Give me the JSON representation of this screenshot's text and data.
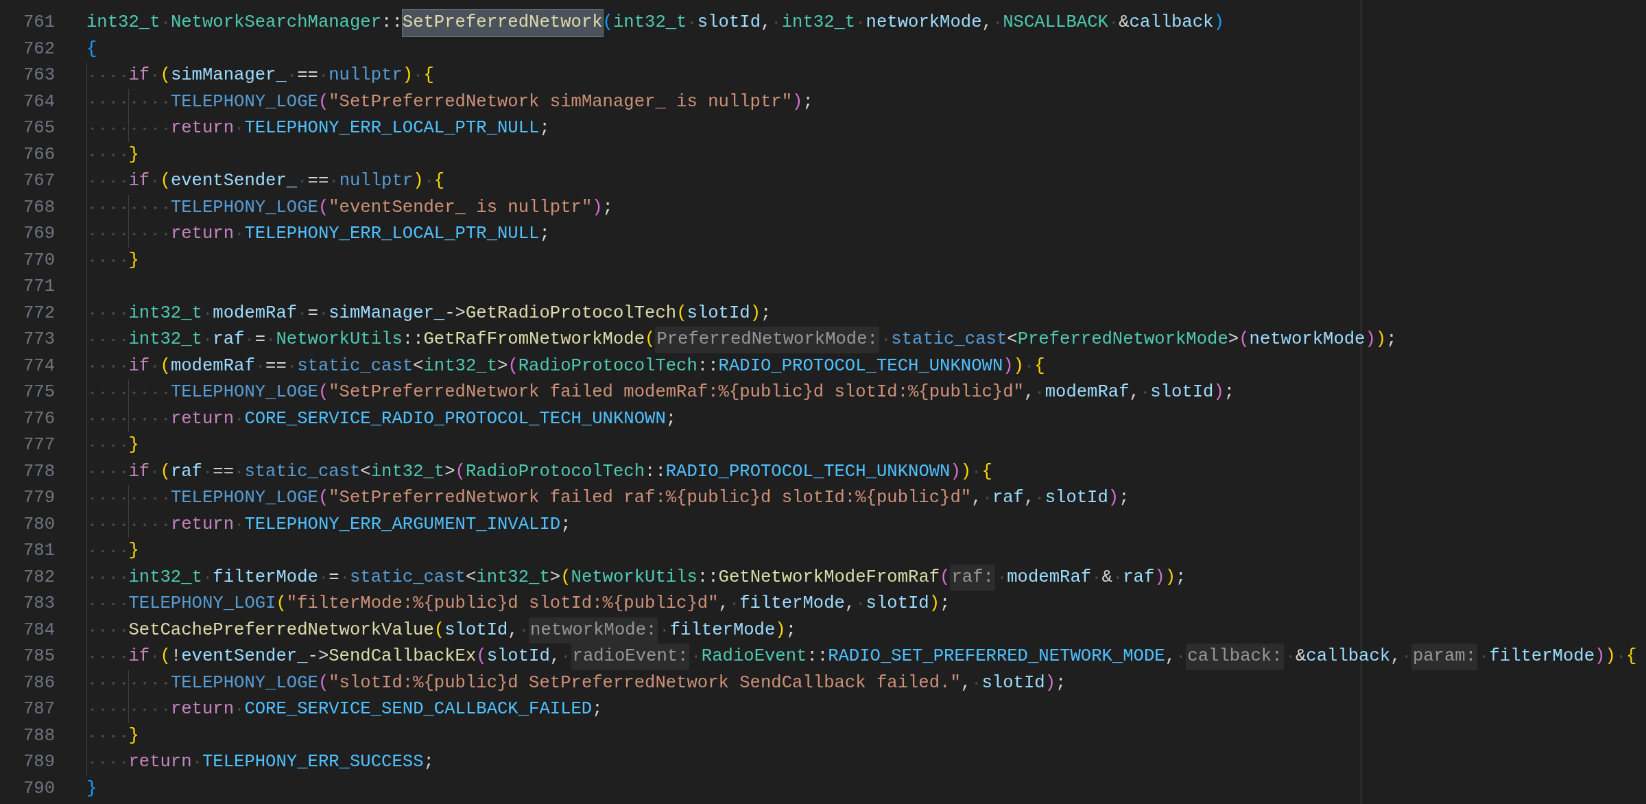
{
  "editor": {
    "lines": [
      {
        "number": "761",
        "tokens": [
          {
            "kind": "type",
            "text": "int32_t"
          },
          {
            "kind": "type",
            "text": "NetworkSearchManager",
            "space_before": true
          },
          {
            "kind": "plain",
            "text": "::"
          },
          {
            "kind": "selected",
            "text": "SetPreferredNetwork"
          },
          {
            "kind": "bracket3",
            "text": "("
          },
          {
            "kind": "type",
            "text": "int32_t"
          },
          {
            "kind": "var",
            "text": "slotId",
            "space_before": true
          },
          {
            "kind": "plain",
            "text": ","
          },
          {
            "kind": "type",
            "text": "int32_t",
            "space_before": true
          },
          {
            "kind": "var",
            "text": "networkMode",
            "space_before": true
          },
          {
            "kind": "plain",
            "text": ","
          },
          {
            "kind": "type",
            "text": "NSCALLBACK",
            "space_before": true
          },
          {
            "kind": "plain",
            "text": "&",
            "space_before": true
          },
          {
            "kind": "var",
            "text": "callback"
          },
          {
            "kind": "bracket3",
            "text": ")"
          }
        ]
      },
      {
        "number": "762",
        "tokens": [
          {
            "kind": "bracket3",
            "text": "{"
          }
        ],
        "children": [
          {
            "number": "763",
            "tokens": [
              {
                "kind": "keyword",
                "text": "if"
              },
              {
                "kind": "bracket1",
                "text": "(",
                "space_before": true
              },
              {
                "kind": "var",
                "text": "simManager_"
              },
              {
                "kind": "plain",
                "text": "==",
                "space_before": true
              },
              {
                "kind": "builtin",
                "text": "nullptr",
                "space_before": true
              },
              {
                "kind": "bracket1",
                "text": ")"
              },
              {
                "kind": "bracket1",
                "text": "{",
                "space_before": true
              }
            ],
            "children": [
              {
                "number": "764",
                "tokens": [
                  {
                    "kind": "macro",
                    "text": "TELEPHONY_LOGE"
                  },
                  {
                    "kind": "bracket2",
                    "text": "("
                  },
                  {
                    "kind": "string",
                    "text": "\"SetPreferredNetwork simManager_ is nullptr\""
                  },
                  {
                    "kind": "bracket2",
                    "text": ")"
                  },
                  {
                    "kind": "plain",
                    "text": ";"
                  }
                ]
              },
              {
                "number": "765",
                "tokens": [
                  {
                    "kind": "keyword",
                    "text": "return"
                  },
                  {
                    "kind": "constant",
                    "text": "TELEPHONY_ERR_LOCAL_PTR_NULL",
                    "space_before": true
                  },
                  {
                    "kind": "plain",
                    "text": ";"
                  }
                ]
              }
            ]
          },
          {
            "number": "766",
            "tokens": [
              {
                "kind": "bracket1",
                "text": "}"
              }
            ]
          },
          {
            "number": "767",
            "tokens": [
              {
                "kind": "keyword",
                "text": "if"
              },
              {
                "kind": "bracket1",
                "text": "(",
                "space_before": true
              },
              {
                "kind": "var",
                "text": "eventSender_"
              },
              {
                "kind": "plain",
                "text": "==",
                "space_before": true
              },
              {
                "kind": "builtin",
                "text": "nullptr",
                "space_before": true
              },
              {
                "kind": "bracket1",
                "text": ")"
              },
              {
                "kind": "bracket1",
                "text": "{",
                "space_before": true
              }
            ],
            "children": [
              {
                "number": "768",
                "tokens": [
                  {
                    "kind": "macro",
                    "text": "TELEPHONY_LOGE"
                  },
                  {
                    "kind": "bracket2",
                    "text": "("
                  },
                  {
                    "kind": "string",
                    "text": "\"eventSender_ is nullptr\""
                  },
                  {
                    "kind": "bracket2",
                    "text": ")"
                  },
                  {
                    "kind": "plain",
                    "text": ";"
                  }
                ]
              },
              {
                "number": "769",
                "tokens": [
                  {
                    "kind": "keyword",
                    "text": "return"
                  },
                  {
                    "kind": "constant",
                    "text": "TELEPHONY_ERR_LOCAL_PTR_NULL",
                    "space_before": true
                  },
                  {
                    "kind": "plain",
                    "text": ";"
                  }
                ]
              }
            ]
          },
          {
            "number": "770",
            "tokens": [
              {
                "kind": "bracket1",
                "text": "}"
              }
            ]
          },
          {
            "number": "771"
          },
          {
            "number": "772",
            "tokens": [
              {
                "kind": "type",
                "text": "int32_t"
              },
              {
                "kind": "var",
                "text": "modemRaf",
                "space_before": true
              },
              {
                "kind": "plain",
                "text": "=",
                "space_before": true
              },
              {
                "kind": "var",
                "text": "simManager_",
                "space_before": true
              },
              {
                "kind": "plain",
                "text": "->"
              },
              {
                "kind": "func",
                "text": "GetRadioProtocolTech"
              },
              {
                "kind": "bracket1",
                "text": "("
              },
              {
                "kind": "var",
                "text": "slotId"
              },
              {
                "kind": "bracket1",
                "text": ")"
              },
              {
                "kind": "plain",
                "text": ";"
              }
            ]
          },
          {
            "number": "773",
            "tokens": [
              {
                "kind": "type",
                "text": "int32_t"
              },
              {
                "kind": "var",
                "text": "raf",
                "space_before": true
              },
              {
                "kind": "plain",
                "text": "=",
                "space_before": true
              },
              {
                "kind": "type",
                "text": "NetworkUtils",
                "space_before": true
              },
              {
                "kind": "plain",
                "text": "::"
              },
              {
                "kind": "func",
                "text": "GetRafFromNetworkMode"
              },
              {
                "kind": "bracket1",
                "text": "("
              },
              {
                "kind": "hint",
                "text": "PreferredNetworkMode:"
              },
              {
                "kind": "builtin",
                "text": "static_cast",
                "space_before": true
              },
              {
                "kind": "plain",
                "text": "<"
              },
              {
                "kind": "type",
                "text": "PreferredNetworkMode"
              },
              {
                "kind": "plain",
                "text": ">"
              },
              {
                "kind": "bracket2",
                "text": "("
              },
              {
                "kind": "var",
                "text": "networkMode"
              },
              {
                "kind": "bracket2",
                "text": ")"
              },
              {
                "kind": "bracket1",
                "text": ")"
              },
              {
                "kind": "plain",
                "text": ";"
              }
            ]
          },
          {
            "number": "774",
            "tokens": [
              {
                "kind": "keyword",
                "text": "if"
              },
              {
                "kind": "bracket1",
                "text": "(",
                "space_before": true
              },
              {
                "kind": "var",
                "text": "modemRaf"
              },
              {
                "kind": "plain",
                "text": "==",
                "space_before": true
              },
              {
                "kind": "builtin",
                "text": "static_cast",
                "space_before": true
              },
              {
                "kind": "plain",
                "text": "<"
              },
              {
                "kind": "type",
                "text": "int32_t"
              },
              {
                "kind": "plain",
                "text": ">"
              },
              {
                "kind": "bracket2",
                "text": "("
              },
              {
                "kind": "type",
                "text": "RadioProtocolTech"
              },
              {
                "kind": "plain",
                "text": "::"
              },
              {
                "kind": "constant",
                "text": "RADIO_PROTOCOL_TECH_UNKNOWN"
              },
              {
                "kind": "bracket2",
                "text": ")"
              },
              {
                "kind": "bracket1",
                "text": ")"
              },
              {
                "kind": "bracket1",
                "text": "{",
                "space_before": true
              }
            ],
            "children": [
              {
                "number": "775",
                "tokens": [
                  {
                    "kind": "macro",
                    "text": "TELEPHONY_LOGE"
                  },
                  {
                    "kind": "bracket2",
                    "text": "("
                  },
                  {
                    "kind": "string",
                    "text": "\"SetPreferredNetwork failed modemRaf:%{public}d slotId:%{public}d\""
                  },
                  {
                    "kind": "plain",
                    "text": ","
                  },
                  {
                    "kind": "var",
                    "text": "modemRaf",
                    "space_before": true
                  },
                  {
                    "kind": "plain",
                    "text": ","
                  },
                  {
                    "kind": "var",
                    "text": "slotId",
                    "space_before": true
                  },
                  {
                    "kind": "bracket2",
                    "text": ")"
                  },
                  {
                    "kind": "plain",
                    "text": ";"
                  }
                ]
              },
              {
                "number": "776",
                "tokens": [
                  {
                    "kind": "keyword",
                    "text": "return"
                  },
                  {
                    "kind": "constant",
                    "text": "CORE_SERVICE_RADIO_PROTOCOL_TECH_UNKNOWN",
                    "space_before": true
                  },
                  {
                    "kind": "plain",
                    "text": ";"
                  }
                ]
              }
            ]
          },
          {
            "number": "777",
            "tokens": [
              {
                "kind": "bracket1",
                "text": "}"
              }
            ]
          },
          {
            "number": "778",
            "tokens": [
              {
                "kind": "keyword",
                "text": "if"
              },
              {
                "kind": "bracket1",
                "text": "(",
                "space_before": true
              },
              {
                "kind": "var",
                "text": "raf"
              },
              {
                "kind": "plain",
                "text": "==",
                "space_before": true
              },
              {
                "kind": "builtin",
                "text": "static_cast",
                "space_before": true
              },
              {
                "kind": "plain",
                "text": "<"
              },
              {
                "kind": "type",
                "text": "int32_t"
              },
              {
                "kind": "plain",
                "text": ">"
              },
              {
                "kind": "bracket2",
                "text": "("
              },
              {
                "kind": "type",
                "text": "RadioProtocolTech"
              },
              {
                "kind": "plain",
                "text": "::"
              },
              {
                "kind": "constant",
                "text": "RADIO_PROTOCOL_TECH_UNKNOWN"
              },
              {
                "kind": "bracket2",
                "text": ")"
              },
              {
                "kind": "bracket1",
                "text": ")"
              },
              {
                "kind": "bracket1",
                "text": "{",
                "space_before": true
              }
            ],
            "children": [
              {
                "number": "779",
                "tokens": [
                  {
                    "kind": "macro",
                    "text": "TELEPHONY_LOGE"
                  },
                  {
                    "kind": "bracket2",
                    "text": "("
                  },
                  {
                    "kind": "string",
                    "text": "\"SetPreferredNetwork failed raf:%{public}d slotId:%{public}d\""
                  },
                  {
                    "kind": "plain",
                    "text": ","
                  },
                  {
                    "kind": "var",
                    "text": "raf",
                    "space_before": true
                  },
                  {
                    "kind": "plain",
                    "text": ","
                  },
                  {
                    "kind": "var",
                    "text": "slotId",
                    "space_before": true
                  },
                  {
                    "kind": "bracket2",
                    "text": ")"
                  },
                  {
                    "kind": "plain",
                    "text": ";"
                  }
                ]
              },
              {
                "number": "780",
                "tokens": [
                  {
                    "kind": "keyword",
                    "text": "return"
                  },
                  {
                    "kind": "constant",
                    "text": "TELEPHONY_ERR_ARGUMENT_INVALID",
                    "space_before": true
                  },
                  {
                    "kind": "plain",
                    "text": ";"
                  }
                ]
              }
            ]
          },
          {
            "number": "781",
            "tokens": [
              {
                "kind": "bracket1",
                "text": "}"
              }
            ]
          },
          {
            "number": "782",
            "tokens": [
              {
                "kind": "type",
                "text": "int32_t"
              },
              {
                "kind": "var",
                "text": "filterMode",
                "space_before": true
              },
              {
                "kind": "plain",
                "text": "=",
                "space_before": true
              },
              {
                "kind": "builtin",
                "text": "static_cast",
                "space_before": true
              },
              {
                "kind": "plain",
                "text": "<"
              },
              {
                "kind": "type",
                "text": "int32_t"
              },
              {
                "kind": "plain",
                "text": ">"
              },
              {
                "kind": "bracket1",
                "text": "("
              },
              {
                "kind": "type",
                "text": "NetworkUtils"
              },
              {
                "kind": "plain",
                "text": "::"
              },
              {
                "kind": "func",
                "text": "GetNetworkModeFromRaf"
              },
              {
                "kind": "bracket2",
                "text": "("
              },
              {
                "kind": "hint",
                "text": "raf:"
              },
              {
                "kind": "var",
                "text": "modemRaf",
                "space_before": true
              },
              {
                "kind": "plain",
                "text": "&",
                "space_before": true
              },
              {
                "kind": "var",
                "text": "raf",
                "space_before": true
              },
              {
                "kind": "bracket2",
                "text": ")"
              },
              {
                "kind": "bracket1",
                "text": ")"
              },
              {
                "kind": "plain",
                "text": ";"
              }
            ]
          },
          {
            "number": "783",
            "tokens": [
              {
                "kind": "macro",
                "text": "TELEPHONY_LOGI"
              },
              {
                "kind": "bracket1",
                "text": "("
              },
              {
                "kind": "string",
                "text": "\"filterMode:%{public}d slotId:%{public}d\""
              },
              {
                "kind": "plain",
                "text": ","
              },
              {
                "kind": "var",
                "text": "filterMode",
                "space_before": true
              },
              {
                "kind": "plain",
                "text": ","
              },
              {
                "kind": "var",
                "text": "slotId",
                "space_before": true
              },
              {
                "kind": "bracket1",
                "text": ")"
              },
              {
                "kind": "plain",
                "text": ";"
              }
            ]
          },
          {
            "number": "784",
            "tokens": [
              {
                "kind": "func",
                "text": "SetCachePreferredNetworkValue"
              },
              {
                "kind": "bracket1",
                "text": "("
              },
              {
                "kind": "var",
                "text": "slotId"
              },
              {
                "kind": "plain",
                "text": ","
              },
              {
                "kind": "hint",
                "text": "networkMode:",
                "space_before": true
              },
              {
                "kind": "var",
                "text": "filterMode",
                "space_before": true
              },
              {
                "kind": "bracket1",
                "text": ")"
              },
              {
                "kind": "plain",
                "text": ";"
              }
            ]
          },
          {
            "number": "785",
            "tokens": [
              {
                "kind": "keyword",
                "text": "if"
              },
              {
                "kind": "bracket1",
                "text": "(",
                "space_before": true
              },
              {
                "kind": "plain",
                "text": "!"
              },
              {
                "kind": "var",
                "text": "eventSender_"
              },
              {
                "kind": "plain",
                "text": "->"
              },
              {
                "kind": "func",
                "text": "SendCallbackEx"
              },
              {
                "kind": "bracket2",
                "text": "("
              },
              {
                "kind": "var",
                "text": "slotId"
              },
              {
                "kind": "plain",
                "text": ","
              },
              {
                "kind": "hint",
                "text": "radioEvent:",
                "space_before": true
              },
              {
                "kind": "type",
                "text": "RadioEvent",
                "space_before": true
              },
              {
                "kind": "plain",
                "text": "::"
              },
              {
                "kind": "constant",
                "text": "RADIO_SET_PREFERRED_NETWORK_MODE"
              },
              {
                "kind": "plain",
                "text": ","
              },
              {
                "kind": "hint",
                "text": "callback:",
                "space_before": true
              },
              {
                "kind": "plain",
                "text": "&",
                "space_before": true
              },
              {
                "kind": "var",
                "text": "callback"
              },
              {
                "kind": "plain",
                "text": ","
              },
              {
                "kind": "hint",
                "text": "param:",
                "space_before": true
              },
              {
                "kind": "var",
                "text": "filterMode",
                "space_before": true
              },
              {
                "kind": "bracket2",
                "text": ")"
              },
              {
                "kind": "bracket1",
                "text": ")"
              },
              {
                "kind": "bracket1",
                "text": "{",
                "space_before": true
              }
            ],
            "children": [
              {
                "number": "786",
                "tokens": [
                  {
                    "kind": "macro",
                    "text": "TELEPHONY_LOGE"
                  },
                  {
                    "kind": "bracket2",
                    "text": "("
                  },
                  {
                    "kind": "string",
                    "text": "\"slotId:%{public}d SetPreferredNetwork SendCallback failed.\""
                  },
                  {
                    "kind": "plain",
                    "text": ","
                  },
                  {
                    "kind": "var",
                    "text": "slotId",
                    "space_before": true
                  },
                  {
                    "kind": "bracket2",
                    "text": ")"
                  },
                  {
                    "kind": "plain",
                    "text": ";"
                  }
                ]
              },
              {
                "number": "787",
                "tokens": [
                  {
                    "kind": "keyword",
                    "text": "return"
                  },
                  {
                    "kind": "constant",
                    "text": "CORE_SERVICE_SEND_CALLBACK_FAILED",
                    "space_before": true
                  },
                  {
                    "kind": "plain",
                    "text": ";"
                  }
                ]
              }
            ]
          },
          {
            "number": "788",
            "tokens": [
              {
                "kind": "bracket1",
                "text": "}"
              }
            ]
          },
          {
            "number": "789",
            "tokens": [
              {
                "kind": "keyword",
                "text": "return"
              },
              {
                "kind": "constant",
                "text": "TELEPHONY_ERR_SUCCESS",
                "space_before": true
              },
              {
                "kind": "plain",
                "text": ";"
              }
            ]
          }
        ]
      },
      {
        "number": "790",
        "tokens": [
          {
            "kind": "bracket3",
            "text": "}"
          }
        ]
      }
    ]
  }
}
